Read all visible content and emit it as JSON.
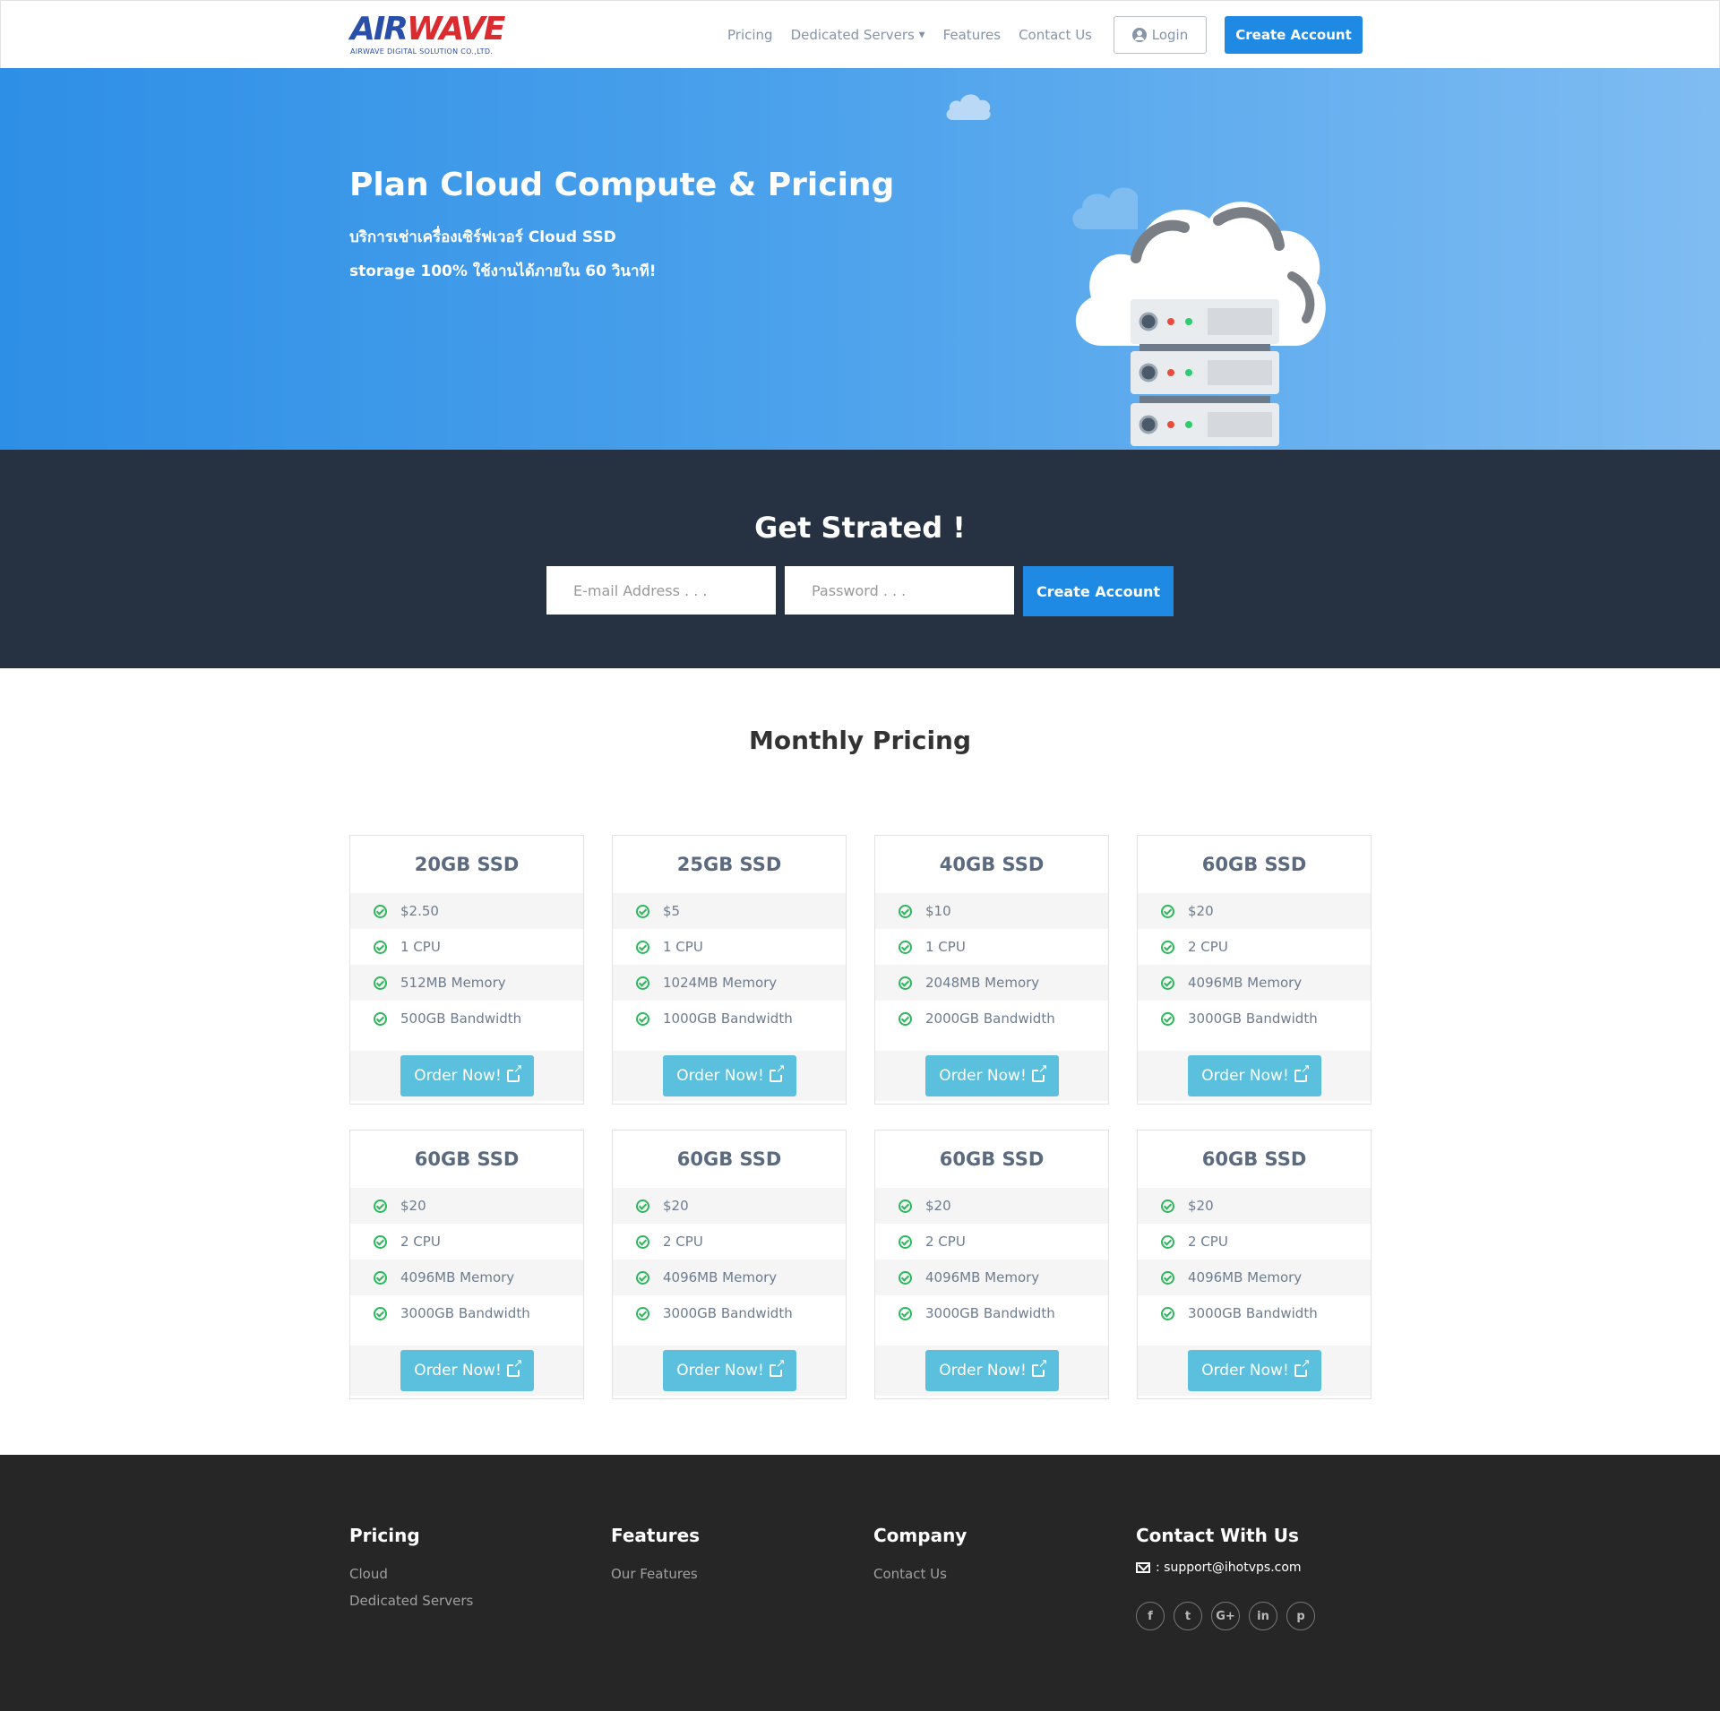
{
  "nav": {
    "logo_text": "AIRWAVE",
    "logo_sub": "AIRWAVE DIGITAL SOLUTION CO.,LTD.",
    "links": [
      "Pricing",
      "Dedicated Servers",
      "Features",
      "Contact Us"
    ],
    "login_label": "Login",
    "create_label": "Create Account"
  },
  "hero": {
    "title": "Plan Cloud Compute & Pricing",
    "subtitle_line1": "บริการเช่าเครื่องเซิร์ฟเวอร์ Cloud SSD",
    "subtitle_line2": "storage 100% ใช้งานได้ภายใน 60 วินาที!"
  },
  "get_started": {
    "title": "Get Strated !",
    "email_placeholder": "E-mail Address . . .",
    "password_placeholder": "Password . . .",
    "button_label": "Create Account"
  },
  "pricing": {
    "title": "Monthly Pricing",
    "order_label": "Order Now!",
    "plans": [
      {
        "name": "20GB SSD",
        "price": "$2.50",
        "cpu": "1 CPU",
        "memory": "512MB Memory",
        "bandwidth": "500GB Bandwidth"
      },
      {
        "name": "25GB SSD",
        "price": "$5",
        "cpu": "1 CPU",
        "memory": "1024MB Memory",
        "bandwidth": "1000GB Bandwidth"
      },
      {
        "name": "40GB SSD",
        "price": "$10",
        "cpu": "1 CPU",
        "memory": "2048MB Memory",
        "bandwidth": "2000GB Bandwidth"
      },
      {
        "name": "60GB SSD",
        "price": "$20",
        "cpu": "2 CPU",
        "memory": "4096MB Memory",
        "bandwidth": "3000GB Bandwidth"
      },
      {
        "name": "60GB SSD",
        "price": "$20",
        "cpu": "2 CPU",
        "memory": "4096MB Memory",
        "bandwidth": "3000GB Bandwidth"
      },
      {
        "name": "60GB SSD",
        "price": "$20",
        "cpu": "2 CPU",
        "memory": "4096MB Memory",
        "bandwidth": "3000GB Bandwidth"
      },
      {
        "name": "60GB SSD",
        "price": "$20",
        "cpu": "2 CPU",
        "memory": "4096MB Memory",
        "bandwidth": "3000GB Bandwidth"
      },
      {
        "name": "60GB SSD",
        "price": "$20",
        "cpu": "2 CPU",
        "memory": "4096MB Memory",
        "bandwidth": "3000GB Bandwidth"
      }
    ]
  },
  "footer": {
    "pricing": {
      "title": "Pricing",
      "links": [
        "Cloud",
        "Dedicated Servers"
      ]
    },
    "features": {
      "title": "Features",
      "links": [
        "Our Features"
      ]
    },
    "company": {
      "title": "Company",
      "links": [
        "Contact Us"
      ]
    },
    "contact": {
      "title": "Contact With Us",
      "email": ": support@ihotvps.com",
      "socials": [
        {
          "icon": "facebook-icon",
          "glyph": "f"
        },
        {
          "icon": "twitter-icon",
          "glyph": "t"
        },
        {
          "icon": "google-plus-icon",
          "glyph": "G+"
        },
        {
          "icon": "linkedin-icon",
          "glyph": "in"
        },
        {
          "icon": "pinterest-icon",
          "glyph": "p"
        }
      ]
    }
  },
  "colors": {
    "primary": "#1f8ae3",
    "dark_band": "#263141",
    "order_button": "#5bc0de",
    "check": "#2db85c",
    "footer_bg": "#262626"
  }
}
